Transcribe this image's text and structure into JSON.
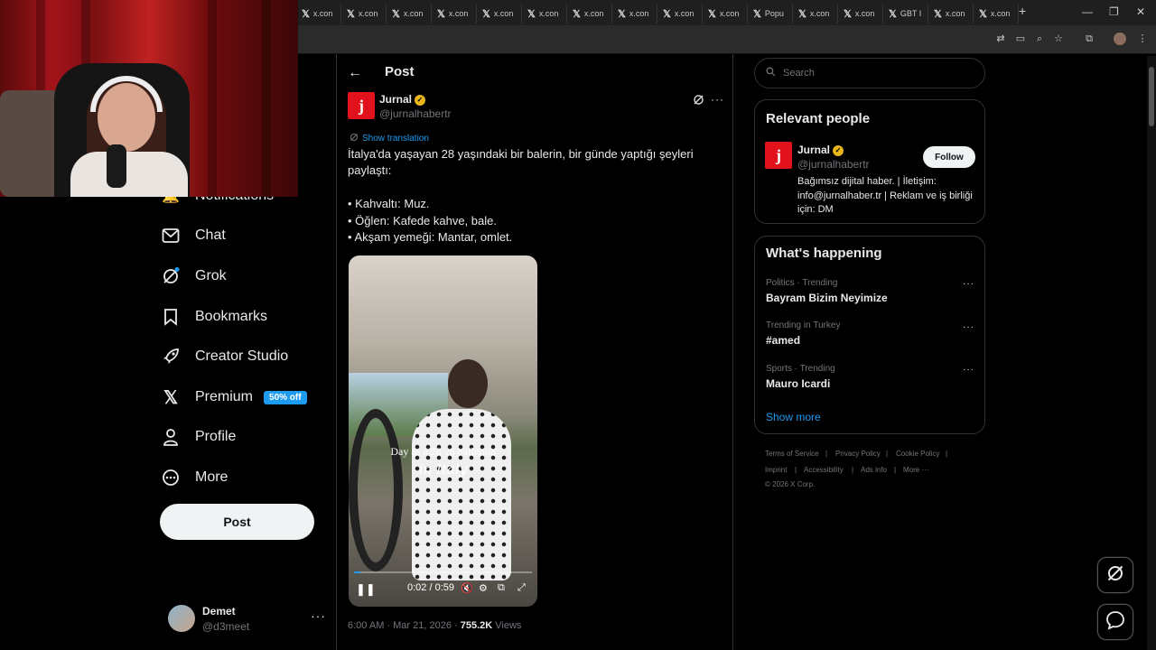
{
  "browser": {
    "tabs": [
      "x.con",
      "x.con",
      "x.con",
      "x.con",
      "x.con",
      "x.con",
      "x.con",
      "x.con",
      "x.con",
      "x.con",
      "Popu",
      "x.con",
      "x.con",
      "GBT I",
      "x.con",
      "x.con"
    ],
    "new_tab": "+",
    "window_controls": [
      "—",
      "❐",
      "✕"
    ]
  },
  "nav": {
    "notifications_label": "Notifications",
    "items": [
      {
        "label": "Chat",
        "icon": "envelope-icon"
      },
      {
        "label": "Grok",
        "icon": "grok-icon"
      },
      {
        "label": "Bookmarks",
        "icon": "bookmark-icon"
      },
      {
        "label": "Creator Studio",
        "icon": "rocket-icon"
      },
      {
        "label": "Premium",
        "icon": "x-logo-icon",
        "badge": "50% off"
      },
      {
        "label": "Profile",
        "icon": "person-icon"
      },
      {
        "label": "More",
        "icon": "more-circle-icon"
      }
    ],
    "post_button": "Post",
    "user": {
      "name": "Demet",
      "handle": "@d3meet",
      "more": "···"
    }
  },
  "post": {
    "header": "Post",
    "back": "←",
    "author": {
      "name": "Jurnal",
      "handle": "@jurnalhabertr",
      "logo": "j"
    },
    "more": "···",
    "show_translation": "Show translation",
    "text_lines": [
      "İtalya'da yaşayan 28 yaşındaki bir balerin, bir günde yaptığı şeyleri",
      "paylaştı:",
      "",
      "• Kahvaltı: Muz.",
      "• Öğlen: Kafede kahve, bale.",
      "• Akşam yemeği: Mantar, omlet."
    ],
    "video": {
      "caption_line1": "Day as a 28 yo ballerina",
      "caption_line2": "in Italy",
      "time": "0:02 / 0:59",
      "progress": 0.034
    },
    "timestamp": "6:00 AM · Mar 21, 2026 · ",
    "views_count": "755.2K",
    "views_label": " Views"
  },
  "sidebar": {
    "search_placeholder": "Search",
    "relevant": {
      "title": "Relevant people",
      "name": "Jurnal",
      "handle": "@jurnalhabertr",
      "follow": "Follow",
      "bio_lines": [
        "Bağımsız dijital haber. | İletişim:",
        "info@jurnalhaber.tr | Reklam ve iş birliği",
        "için: DM"
      ]
    },
    "happening": {
      "title": "What's happening",
      "trends": [
        {
          "category": "Politics · Trending",
          "name": "Bayram Bizim Neyimize"
        },
        {
          "category": "Trending in Turkey",
          "name": "#amed"
        },
        {
          "category": "Sports · Trending",
          "name": "Mauro Icardi"
        }
      ],
      "show_more": "Show more"
    },
    "footer": {
      "row1": [
        "Terms of Service",
        "|",
        "Privacy Policy",
        "|",
        "Cookie Policy",
        "|"
      ],
      "row2": [
        "Imprint",
        "|",
        "Accessibility",
        "|",
        "Ads info",
        "|",
        "More ···"
      ],
      "copyright": "© 2026 X Corp."
    }
  },
  "colors": {
    "accent": "#1d9bf0",
    "background": "#000000",
    "brand_red": "#e1121b"
  }
}
